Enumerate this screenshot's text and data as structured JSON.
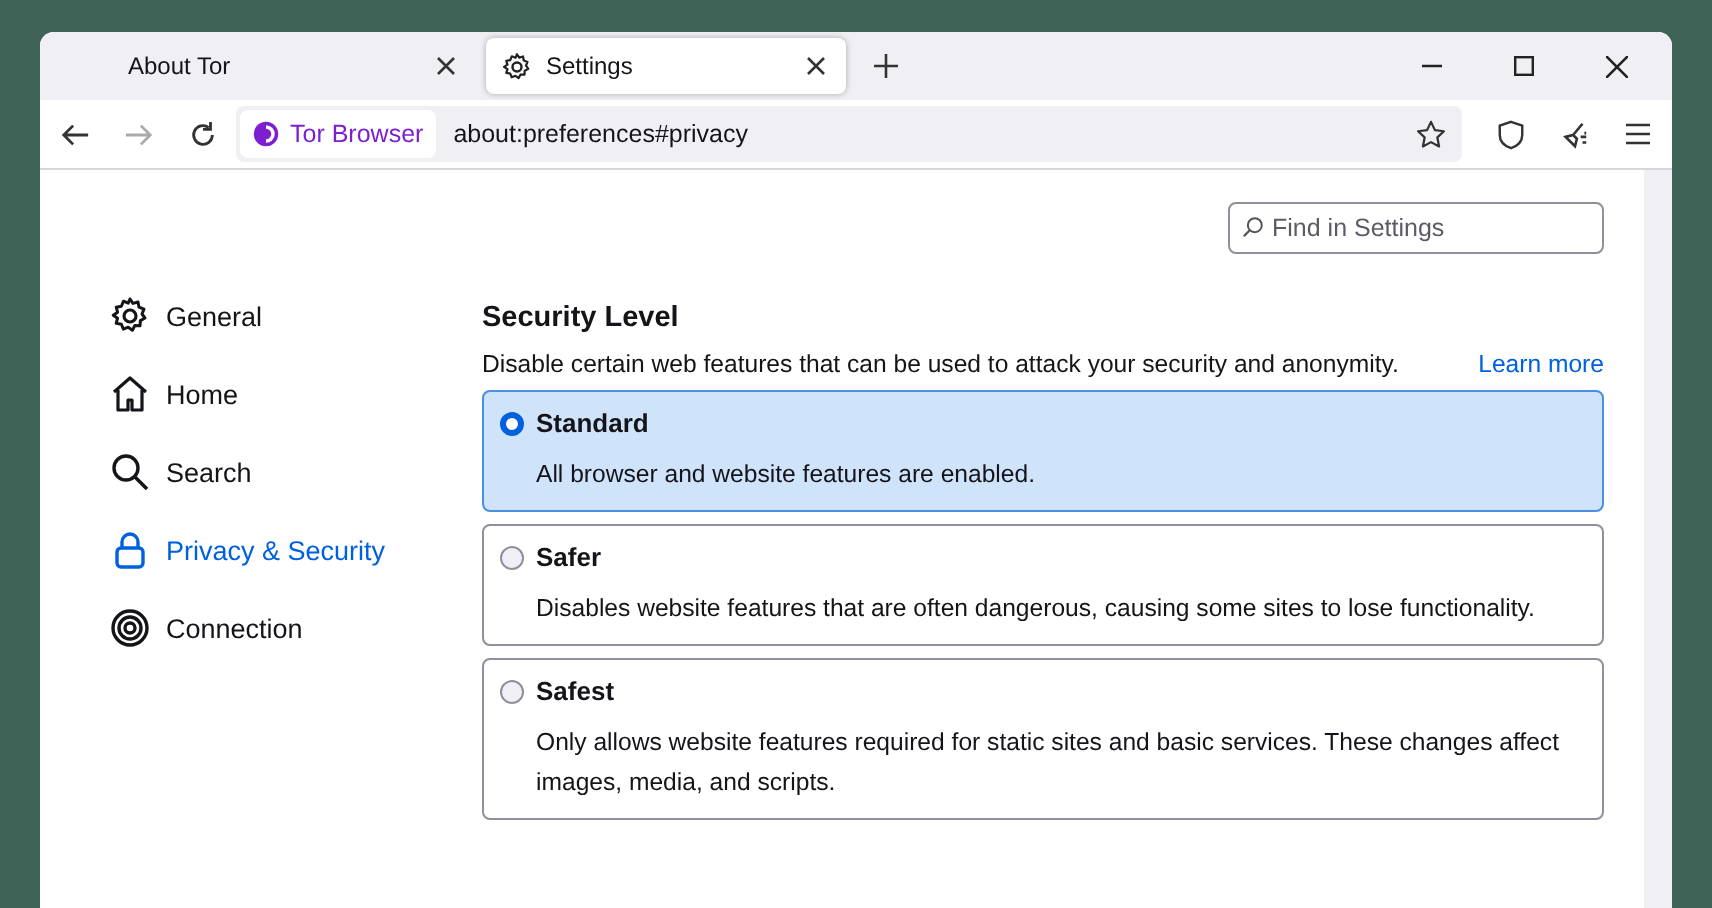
{
  "tabs": [
    {
      "label": "About Tor",
      "selected": false
    },
    {
      "label": "Settings",
      "selected": true
    }
  ],
  "toolbar": {
    "identity": "Tor Browser",
    "url": "about:preferences#privacy"
  },
  "search": {
    "placeholder": "Find in Settings"
  },
  "sidebar": {
    "items": [
      {
        "label": "General",
        "selected": false
      },
      {
        "label": "Home",
        "selected": false
      },
      {
        "label": "Search",
        "selected": false
      },
      {
        "label": "Privacy & Security",
        "selected": true
      },
      {
        "label": "Connection",
        "selected": false
      }
    ]
  },
  "security_level": {
    "title": "Security Level",
    "description": "Disable certain web features that can be used to attack your security and anonymity.",
    "link": "Learn more",
    "options": [
      {
        "label": "Standard",
        "description": "All browser and website features are enabled.",
        "selected": true
      },
      {
        "label": "Safer",
        "description": "Disables website features that are often dangerous, causing some sites to lose functionality.",
        "selected": false
      },
      {
        "label": "Safest",
        "description": "Only allows website features required for static sites and basic services. These changes affect images, media, and scripts.",
        "selected": false
      }
    ]
  }
}
